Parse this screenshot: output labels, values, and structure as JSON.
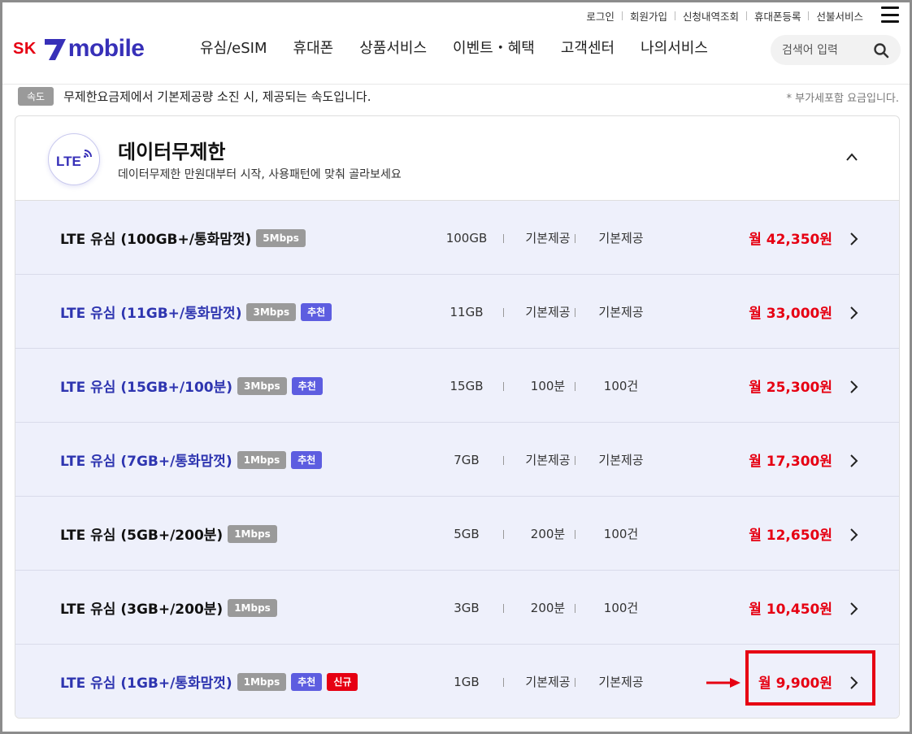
{
  "util_links": [
    "로그인",
    "회원가입",
    "신청내역조회",
    "휴대폰등록",
    "선불서비스"
  ],
  "logo": {
    "sk": "SK",
    "mobile": "mobile"
  },
  "gnb": [
    "유심/eSIM",
    "휴대폰",
    "상품서비스",
    "이벤트・혜택",
    "고객센터",
    "나의서비스"
  ],
  "search": {
    "placeholder": "검색어 입력"
  },
  "speed_info": {
    "tag": "속도",
    "text": "무제한요금제에서 기본제공량 소진 시, 제공되는 속도입니다.",
    "vat": "* 부가세포함 요금입니다."
  },
  "card": {
    "icon_text": "LTE",
    "title": "데이터무제한",
    "subtitle": "데이터무제한 만원대부터 시작, 사용패턴에 맞춰 골라보세요"
  },
  "plans": [
    {
      "name": "LTE 유심 (100GB+/통화맘껏)",
      "color": "black",
      "badges": [
        "5Mbps"
      ],
      "data": "100GB",
      "voice": "기본제공",
      "sms": "기본제공",
      "price": "월 42,350원"
    },
    {
      "name": "LTE 유심 (11GB+/통화맘껏)",
      "color": "blue",
      "badges": [
        "3Mbps",
        "추천"
      ],
      "data": "11GB",
      "voice": "기본제공",
      "sms": "기본제공",
      "price": "월 33,000원"
    },
    {
      "name": "LTE 유심 (15GB+/100분)",
      "color": "blue",
      "badges": [
        "3Mbps",
        "추천"
      ],
      "data": "15GB",
      "voice": "100분",
      "sms": "100건",
      "price": "월 25,300원"
    },
    {
      "name": "LTE 유심 (7GB+/통화맘껏)",
      "color": "blue",
      "badges": [
        "1Mbps",
        "추천"
      ],
      "data": "7GB",
      "voice": "기본제공",
      "sms": "기본제공",
      "price": "월 17,300원"
    },
    {
      "name": "LTE 유심 (5GB+/200분)",
      "color": "black",
      "badges": [
        "1Mbps"
      ],
      "data": "5GB",
      "voice": "200분",
      "sms": "100건",
      "price": "월 12,650원"
    },
    {
      "name": "LTE 유심 (3GB+/200분)",
      "color": "black",
      "badges": [
        "1Mbps"
      ],
      "data": "3GB",
      "voice": "200분",
      "sms": "100건",
      "price": "월 10,450원"
    },
    {
      "name": "LTE 유심 (1GB+/통화맘껏)",
      "color": "blue",
      "badges": [
        "1Mbps",
        "추천",
        "신규"
      ],
      "data": "1GB",
      "voice": "기본제공",
      "sms": "기본제공",
      "price": "월 9,900원"
    }
  ],
  "colors": {
    "brand_blue": "#3730b8",
    "brand_red": "#e60012",
    "row_bg": "#eef0fb",
    "recommend": "#5d5de0"
  }
}
